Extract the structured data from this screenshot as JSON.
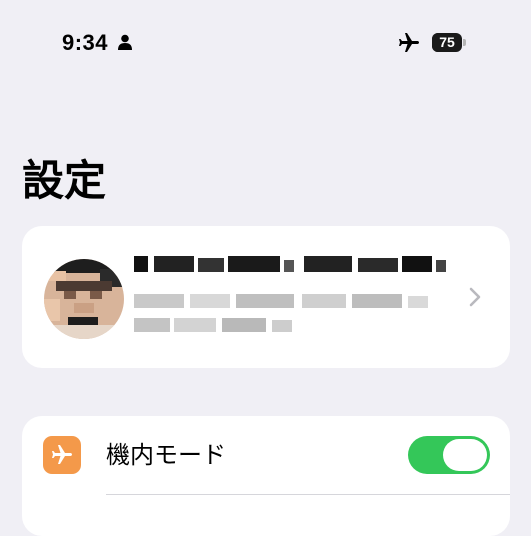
{
  "status_bar": {
    "time": "9:34",
    "battery_percent": 75,
    "battery_label": "75",
    "icons": [
      "person-icon",
      "airplane-icon",
      "battery-icon"
    ]
  },
  "page": {
    "title": "設定"
  },
  "profile": {
    "avatar": "avatar-image (pixelated)",
    "name_redacted": true,
    "details_redacted": true,
    "chevron": "chevron-right-icon"
  },
  "settings": {
    "items": [
      {
        "label": "機内モード",
        "icon": "airplane-icon",
        "icon_color": "#f4994a",
        "toggle_on": true,
        "toggle_color": "#34c759"
      }
    ]
  }
}
